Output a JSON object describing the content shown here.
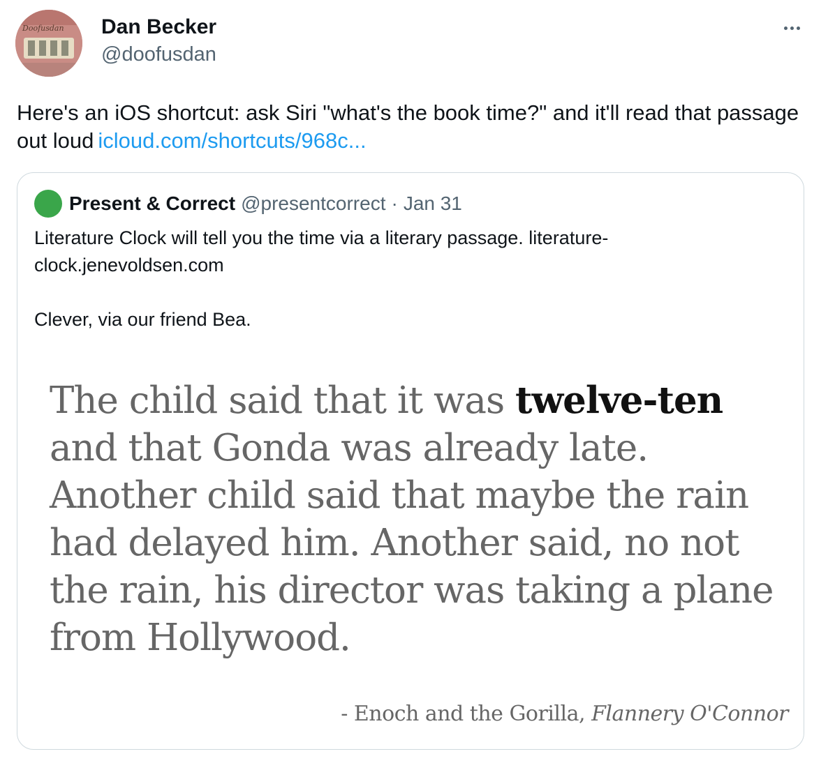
{
  "tweet": {
    "author_name": "Dan Becker",
    "author_handle": "@doofusdan",
    "avatar_label": "Doofusdan",
    "more_icon": "more-horizontal-icon",
    "text": "Here's an iOS shortcut: ask Siri \"what's the book time?\" and it'll read that passage out loud",
    "link_text": "icloud.com/shortcuts/968c..."
  },
  "quote": {
    "author_name": "Present & Correct",
    "author_handle": "@presentcorrect",
    "separator": "·",
    "date": "Jan 31",
    "text_line1": "Literature Clock will tell you the time via a literary passage. literature-clock.jenevoldsen.com",
    "text_line2": "Clever, via our friend Bea.",
    "passage_before": "The child said that it was ",
    "passage_time": "twelve-ten",
    "passage_after": " and that Gonda was already late. Another child said that maybe the rain had delayed him. Another said, no not the rain, his director was taking a plane from Hollywood.",
    "attribution_prefix": "- Enoch and the Gorilla, ",
    "attribution_author": "Flannery O'Connor"
  },
  "colors": {
    "link": "#1d9bf0",
    "secondary_text": "#536471",
    "quote_avatar": "#3aa64a",
    "card_border": "#cfd9de"
  }
}
